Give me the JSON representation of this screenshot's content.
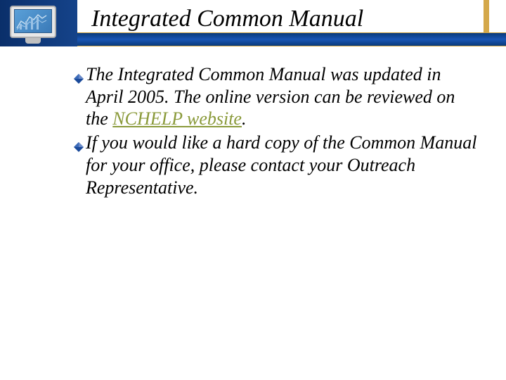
{
  "header": {
    "title": "Integrated Common Manual",
    "icon_name": "computer-monitor-icon"
  },
  "bullets": [
    {
      "pre": "The Integrated Common Manual was updated in April 2005. The online version can be reviewed on the ",
      "link_text": "NCHELP website",
      "post": "."
    },
    {
      "pre": "If you would like a hard copy of the Common Manual for your office, please contact your Outreach Representative.",
      "link_text": "",
      "post": ""
    }
  ],
  "colors": {
    "bullet_fill": "#1a4a9a",
    "bullet_light": "#6a8ac8",
    "link": "#8a9a3a"
  }
}
